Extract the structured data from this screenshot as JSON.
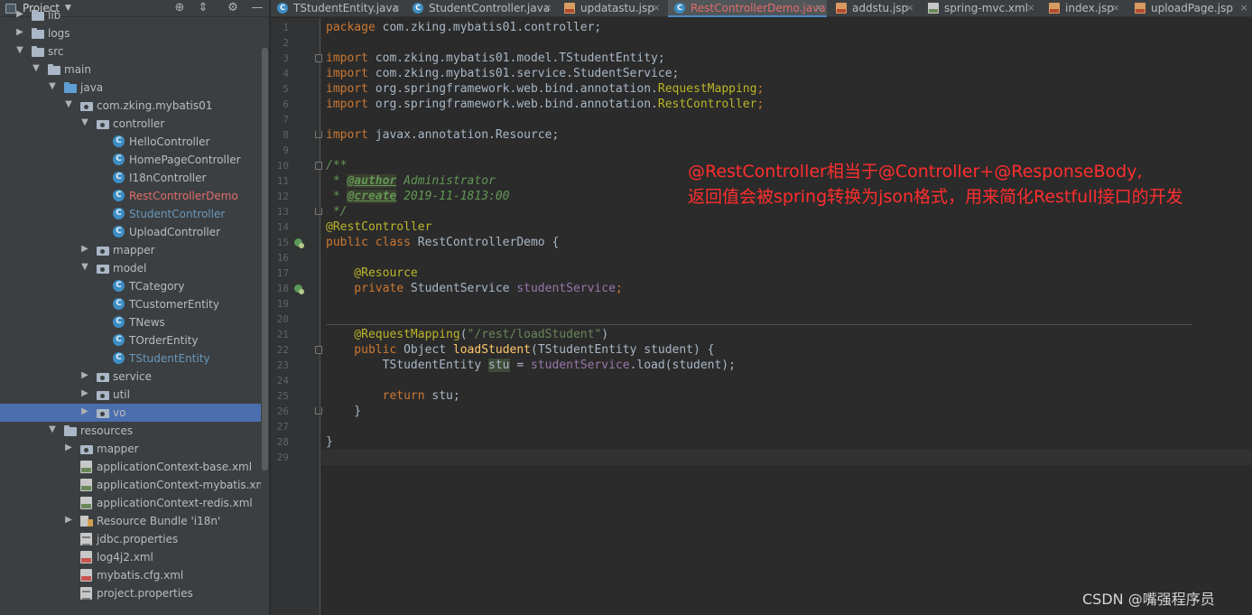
{
  "project_panel": {
    "title": "Project",
    "tree": [
      {
        "label": "lib",
        "icon": "folder-icon",
        "arrow": "collapsed"
      },
      {
        "label": "logs",
        "icon": "folder-icon",
        "arrow": "collapsed"
      },
      {
        "label": "src",
        "icon": "folder-icon",
        "arrow": "expanded"
      },
      {
        "label": "main",
        "icon": "folder-icon",
        "arrow": "expanded"
      },
      {
        "label": "java",
        "icon": "source-folder-icon",
        "arrow": "expanded"
      },
      {
        "label": "com.zking.mybatis01",
        "icon": "package-icon",
        "arrow": "expanded"
      },
      {
        "label": "controller",
        "icon": "package-icon",
        "arrow": "expanded"
      },
      {
        "label": "HelloController",
        "icon": "class-icon"
      },
      {
        "label": "HomePageController",
        "icon": "class-icon"
      },
      {
        "label": "I18nController",
        "icon": "class-icon"
      },
      {
        "label": "RestControllerDemo",
        "icon": "class-icon",
        "color": "red"
      },
      {
        "label": "StudentController",
        "icon": "class-icon",
        "color": "blue"
      },
      {
        "label": "UploadController",
        "icon": "class-icon"
      },
      {
        "label": "mapper",
        "icon": "package-icon",
        "arrow": "collapsed"
      },
      {
        "label": "model",
        "icon": "package-icon",
        "arrow": "expanded"
      },
      {
        "label": "TCategory",
        "icon": "class-icon"
      },
      {
        "label": "TCustomerEntity",
        "icon": "class-icon"
      },
      {
        "label": "TNews",
        "icon": "class-icon"
      },
      {
        "label": "TOrderEntity",
        "icon": "class-icon"
      },
      {
        "label": "TStudentEntity",
        "icon": "class-icon",
        "color": "blue"
      },
      {
        "label": "service",
        "icon": "package-icon",
        "arrow": "collapsed"
      },
      {
        "label": "util",
        "icon": "package-icon",
        "arrow": "collapsed"
      },
      {
        "label": "vo",
        "icon": "package-icon",
        "arrow": "collapsed",
        "selected": true
      },
      {
        "label": "resources",
        "icon": "resources-folder-icon",
        "arrow": "expanded"
      },
      {
        "label": "mapper",
        "icon": "package-icon",
        "arrow": "collapsed"
      },
      {
        "label": "applicationContext-base.xml",
        "icon": "xml-file-icon"
      },
      {
        "label": "applicationContext-mybatis.xml",
        "icon": "xml-file-icon"
      },
      {
        "label": "applicationContext-redis.xml",
        "icon": "xml-file-icon"
      },
      {
        "label": "Resource Bundle 'i18n'",
        "icon": "resource-bundle-icon",
        "arrow": "collapsed"
      },
      {
        "label": "jdbc.properties",
        "icon": "properties-file-icon"
      },
      {
        "label": "log4j2.xml",
        "icon": "xml-file-icon"
      },
      {
        "label": "mybatis.cfg.xml",
        "icon": "xml-file-icon"
      },
      {
        "label": "project.properties",
        "icon": "properties-file-icon"
      }
    ]
  },
  "tabs": [
    {
      "label": "TStudentEntity.java",
      "icon": "java-class-icon"
    },
    {
      "label": "StudentController.java",
      "icon": "java-class-icon"
    },
    {
      "label": "updatastu.jsp",
      "icon": "jsp-file-icon"
    },
    {
      "label": "RestControllerDemo.java",
      "icon": "java-class-icon",
      "active": true
    },
    {
      "label": "addstu.jsp",
      "icon": "jsp-file-icon"
    },
    {
      "label": "spring-mvc.xml",
      "icon": "xml-file-icon"
    },
    {
      "label": "index.jsp",
      "icon": "jsp-file-icon"
    },
    {
      "label": "uploadPage.jsp",
      "icon": "jsp-file-icon"
    }
  ],
  "tab_close_glyph": "×",
  "line_numbers": [
    "1",
    "2",
    "3",
    "4",
    "5",
    "6",
    "7",
    "8",
    "9",
    "10",
    "11",
    "12",
    "13",
    "14",
    "15",
    "16",
    "17",
    "18",
    "19",
    "20",
    "21",
    "22",
    "23",
    "24",
    "25",
    "26",
    "27",
    "28",
    "29"
  ],
  "code": {
    "l1_kw": "package",
    "l1_rest": " com.zking.mybatis01.controller;",
    "l3_kw": "import",
    "l3_rest": " com.zking.mybatis01.model.TStudentEntity;",
    "l4_kw": "import",
    "l4_rest": " com.zking.mybatis01.service.StudentService;",
    "l5_kw": "import",
    "l5_pre": " org.springframework.web.bind.annotation.",
    "l5_an": "RequestMapping",
    "l5_end": ";",
    "l6_kw": "import",
    "l6_pre": " org.springframework.web.bind.annotation.",
    "l6_an": "RestController",
    "l6_end": ";",
    "l8_kw": "import",
    "l8_rest": " javax.annotation.Resource;",
    "l10": "/**",
    "l11_pre": " * ",
    "l11_tag": "@author",
    "l11_rest": " Administrator",
    "l12_pre": " * ",
    "l12_tag": "@create",
    "l12_rest": " 2019-11-1813:00",
    "l13": " */",
    "l14": "@RestController",
    "l15_kw": "public class",
    "l15_rest": " RestControllerDemo {",
    "l17": "    @Resource",
    "l18_kw": "    private",
    "l18_mid": " StudentService ",
    "l18_fld": "studentService",
    "l18_end": ";",
    "l21_an": "    @RequestMapping",
    "l21_p1": "(",
    "l21_str": "\"/rest/loadStudent\"",
    "l21_p2": ")",
    "l22_kw": "    public",
    "l22_mid": " Object ",
    "l22_fn": "loadStudent",
    "l22_rest": "(TStudentEntity student) {",
    "l23_pre": "        TStudentEntity ",
    "l23_var": "stu",
    "l23_eq": " = ",
    "l23_fld": "studentService",
    "l23_rest": ".load(student);",
    "l25_kw": "        return",
    "l25_rest": " stu;",
    "l26": "    }",
    "l28": "}"
  },
  "annotation": {
    "line1": "@RestController相当于@Controller+@ResponseBody,",
    "line2": "返回值会被spring转换为json格式，用来简化Restfull接口的开发",
    "color": "#ff2e2e"
  },
  "watermark": "CSDN @嘴强程序员",
  "colors": {
    "keyword": "#cc7832",
    "annotation": "#bbb529",
    "string": "#6a8759",
    "field": "#9876aa",
    "method": "#ffc66d",
    "selection": "#4b6eaf"
  }
}
